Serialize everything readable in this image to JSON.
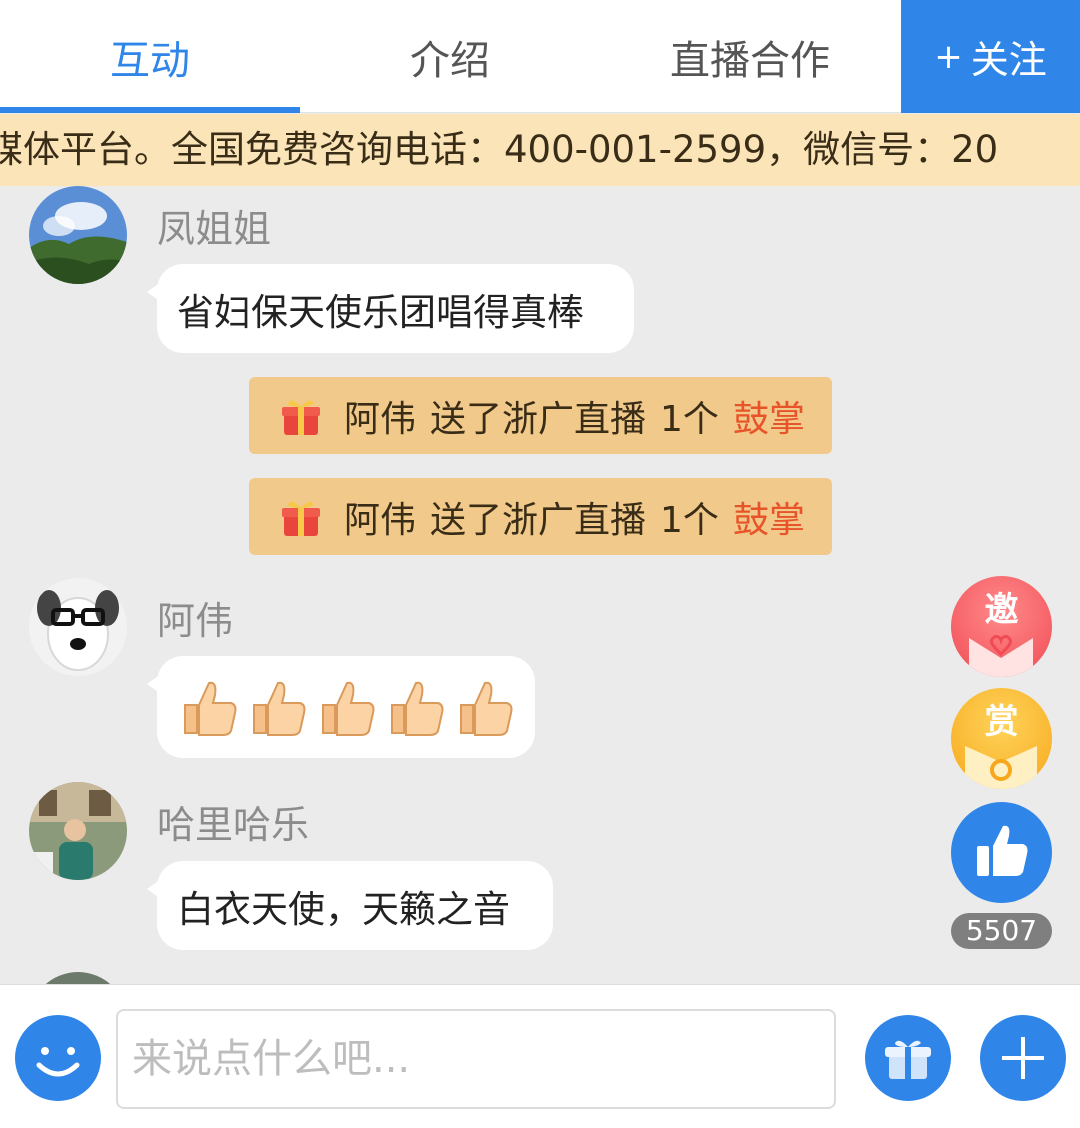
{
  "tabs": [
    {
      "label": "互动",
      "active": true
    },
    {
      "label": "介绍",
      "active": false
    },
    {
      "label": "直播合作",
      "active": false
    }
  ],
  "follow_button": {
    "plus": "+",
    "label": "关注"
  },
  "marquee_text": "媒体平台。全国免费咨询电话：400-001-2599，微信号：20",
  "messages": [
    {
      "user": "凤姐姐",
      "text": "省妇保天使乐团唱得真棒"
    },
    {
      "user": "阿伟",
      "text": ""
    },
    {
      "user": "哈里哈乐",
      "text": "白衣天使，天籁之音"
    }
  ],
  "gift_banners": [
    {
      "sender": "阿伟",
      "action": "送了浙广直播",
      "count": "1个",
      "gift": "鼓掌"
    },
    {
      "sender": "阿伟",
      "action": "送了浙广直播",
      "count": "1个",
      "gift": "鼓掌"
    }
  ],
  "side_buttons": {
    "invite": "邀",
    "reward": "赏",
    "like_count": "5507"
  },
  "input": {
    "placeholder": "来说点什么吧..."
  },
  "icons": {
    "gift": "gift-icon",
    "thumbs_up": "thumbs-up-emoji-icon",
    "emoji": "smiley-icon",
    "plus": "plus-icon",
    "like": "like-icon"
  },
  "colors": {
    "accent": "#2f86e8",
    "banner_bg": "#fbe5b8",
    "gift_bg": "#f1c98a",
    "gift_name": "#e8542a"
  }
}
